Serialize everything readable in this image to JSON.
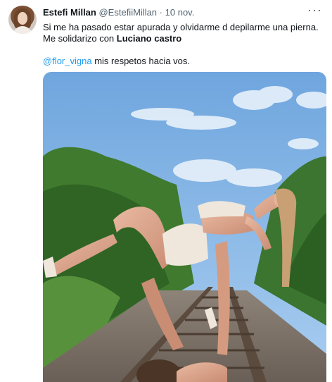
{
  "tweet": {
    "author_name": "Estefi Millan",
    "author_handle": "@EstefiiMillan",
    "separator": "·",
    "date": "10 nov.",
    "more_label": "···",
    "line1": "Si me ha pasado estar apurada y olvidarme d depilarme una pierna.",
    "line2_prefix": "Me solidarizo con ",
    "line2_bold": "Luciano castro",
    "mention": "@flor_vigna",
    "line3_rest": " mis respetos hacia vos."
  },
  "media": {
    "type": "photo",
    "alt_icon": "photo-acrobatics-on-railway"
  },
  "colors": {
    "text": "#0f1419",
    "secondary": "#536471",
    "link": "#1d9bf0",
    "sky": "#7fb1e3"
  }
}
